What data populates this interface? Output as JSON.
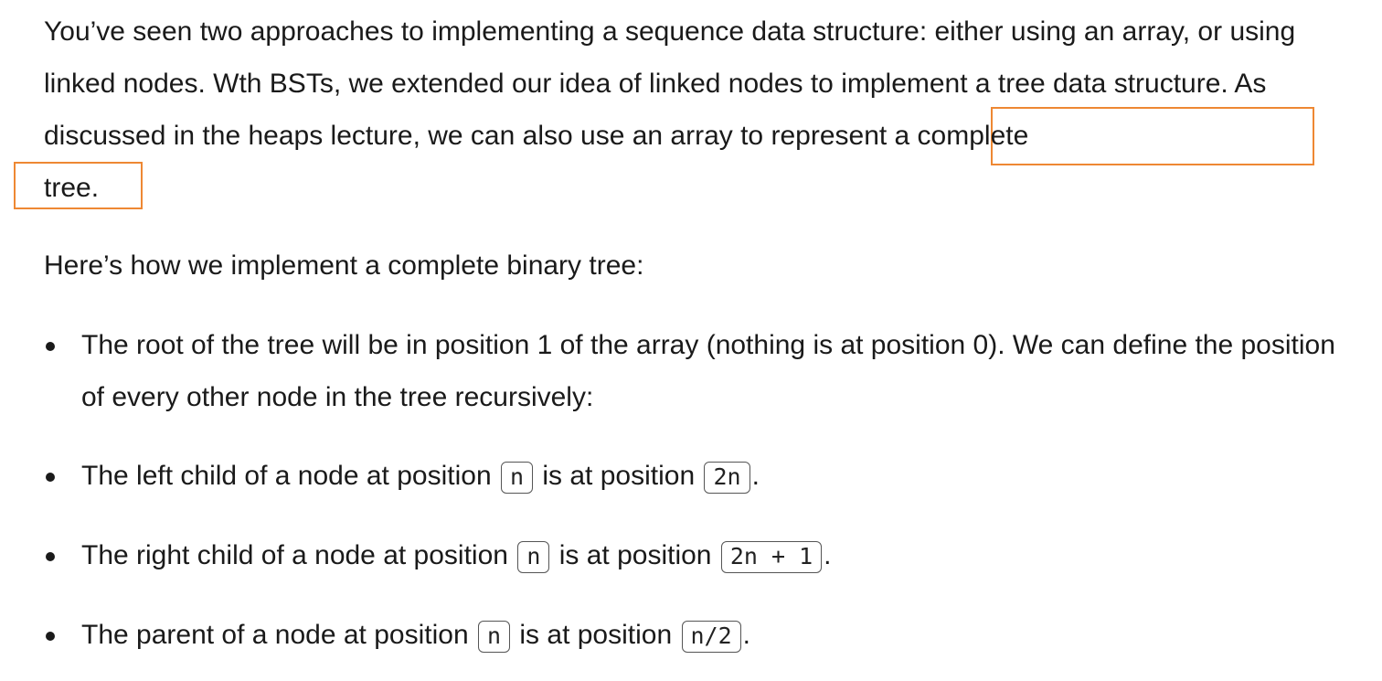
{
  "intro": {
    "part1": "You’ve seen two approaches to implementing a sequence data structure: either using an array, or using linked nodes. Wth BSTs, we extended our idea of linked nodes to implement a tree data structure. As discussed in the heaps lecture, we can also use an array to",
    "highlight_line1": "represent a complete",
    "highlight_line2": "tree."
  },
  "lead": "Here’s how we implement a complete binary tree:",
  "bullets": [
    {
      "text": "The root of the tree will be in position 1 of the array (nothing is at position 0). We can define the position of every other node in the tree recursively:"
    },
    {
      "prefix": "The left child of a node at position",
      "code1": "n",
      "middle": "is at position",
      "code2": "2n",
      "suffix": "."
    },
    {
      "prefix": "The right child of a node at position",
      "code1": "n",
      "middle": "is at position",
      "code2": "2n + 1",
      "suffix": "."
    },
    {
      "prefix": "The parent of a node at position",
      "code1": "n",
      "middle": "is at position",
      "code2": "n/2",
      "suffix": "."
    }
  ],
  "colors": {
    "highlight_border": "#ee8833",
    "text": "#1a1a1a"
  }
}
